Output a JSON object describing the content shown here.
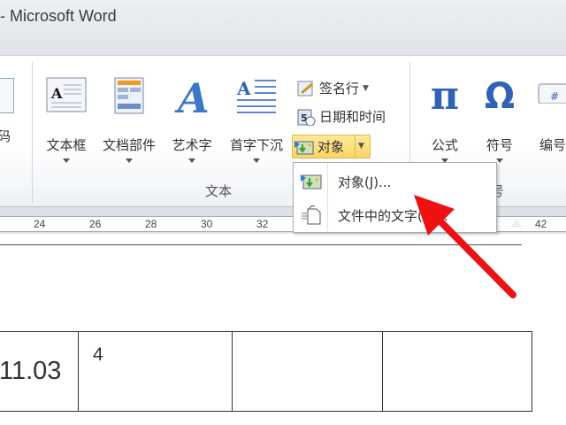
{
  "window": {
    "title": "- Microsoft Word"
  },
  "ribbon": {
    "partial_left_label": "码",
    "text_group": {
      "label": "文本",
      "buttons": [
        {
          "label": "文本框",
          "icon": "text-box-icon"
        },
        {
          "label": "文档部件",
          "icon": "quick-parts-icon"
        },
        {
          "label": "艺术字",
          "icon": "wordart-icon"
        },
        {
          "label": "首字下沉",
          "icon": "drop-cap-icon"
        }
      ],
      "small_buttons": [
        {
          "label": "签名行",
          "icon": "signature-line-icon"
        },
        {
          "label": "日期和时间",
          "icon": "date-time-icon"
        },
        {
          "label": "对象",
          "icon": "object-icon",
          "state": "pressed"
        }
      ]
    },
    "symbols_group": {
      "label": "符号",
      "buttons": [
        {
          "label": "公式",
          "icon": "pi-icon"
        },
        {
          "label": "符号",
          "icon": "omega-icon"
        },
        {
          "label": "编号",
          "icon": "number-icon"
        }
      ]
    }
  },
  "ruler": {
    "ticks": [
      "24",
      "26",
      "28",
      "30",
      "32",
      "42"
    ]
  },
  "menu": {
    "items": [
      {
        "label": "对象(J)...",
        "icon": "object-icon"
      },
      {
        "label": "文件中的文字(F)...",
        "icon": "text-from-file-icon"
      }
    ]
  },
  "document": {
    "table": {
      "cells": [
        "11.03",
        "4",
        "",
        ""
      ]
    }
  },
  "annotation": {
    "arrow_color": "#ee1111"
  }
}
